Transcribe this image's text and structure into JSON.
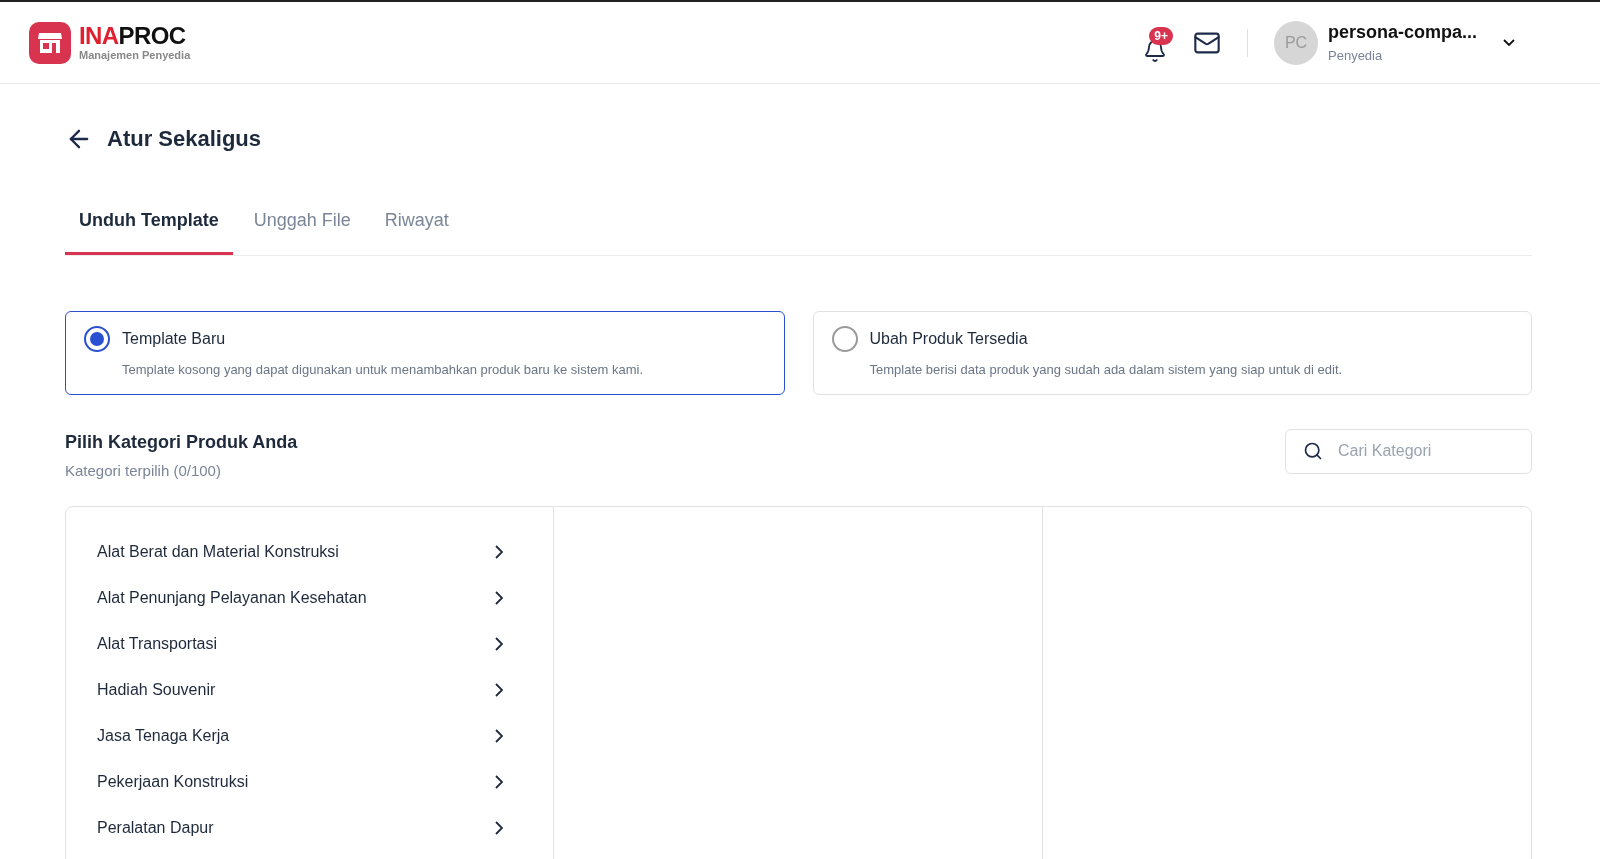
{
  "header": {
    "logo": {
      "part_1": "INA",
      "part_2": "PROC",
      "subtitle": "Manajemen Penyedia"
    },
    "notification_badge": "9+",
    "user": {
      "initials": "PC",
      "name": "persona-compa...",
      "role": "Penyedia"
    }
  },
  "page": {
    "title": "Atur Sekaligus"
  },
  "tabs": [
    {
      "label": "Unduh Template",
      "selected": true
    },
    {
      "label": "Unggah File",
      "selected": false
    },
    {
      "label": "Riwayat",
      "selected": false
    }
  ],
  "template_options": [
    {
      "title": "Template Baru",
      "description": "Template kosong yang dapat digunakan untuk menambahkan produk baru ke sistem kami.",
      "selected": true
    },
    {
      "title": "Ubah Produk Tersedia",
      "description": "Template berisi data produk yang sudah ada dalam sistem yang siap untuk di edit.",
      "selected": false
    }
  ],
  "category_section": {
    "title": "Pilih Kategori Produk Anda",
    "subtitle": "Kategori terpilih (0/100)",
    "search": {
      "placeholder": "Cari Kategori"
    },
    "categories": [
      "Alat Berat dan Material Konstruksi",
      "Alat Penunjang Pelayanan Kesehatan",
      "Alat Transportasi",
      "Hadiah Souvenir",
      "Jasa Tenaga Kerja",
      "Pekerjaan Konstruksi",
      "Peralatan Dapur"
    ]
  }
}
